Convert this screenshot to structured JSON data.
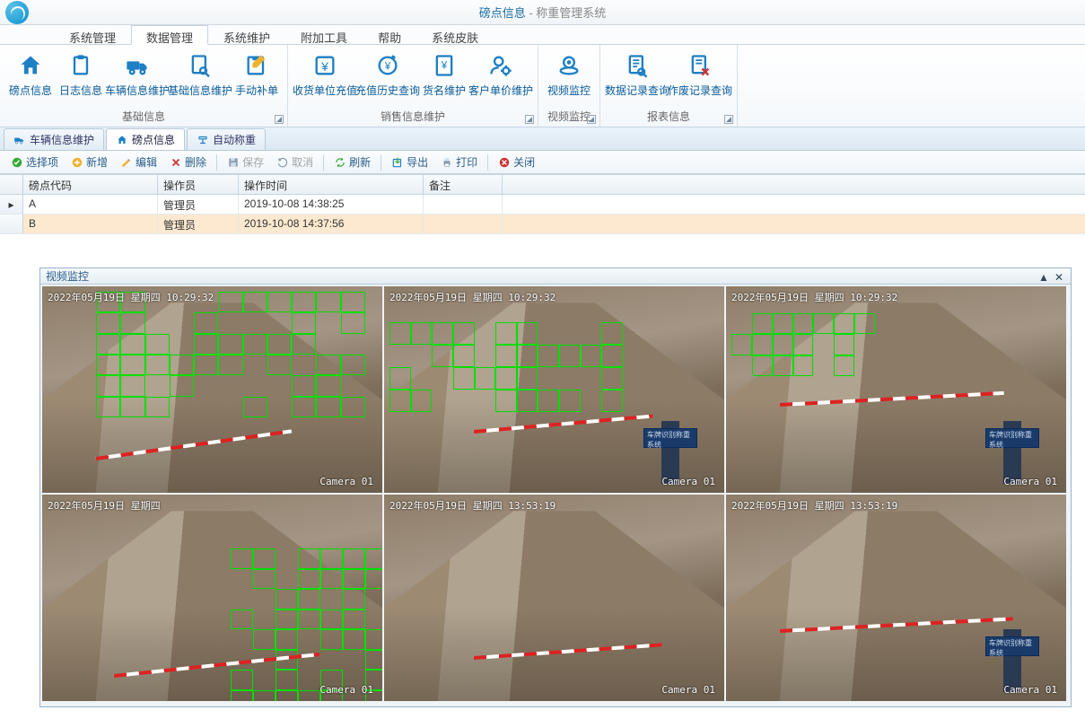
{
  "title": {
    "main": "磅点信息",
    "sub": " - 称重管理系统"
  },
  "mainmenu": [
    {
      "label": "系统管理"
    },
    {
      "label": "数据管理",
      "active": true
    },
    {
      "label": "系统维护"
    },
    {
      "label": "附加工具"
    },
    {
      "label": "帮助"
    },
    {
      "label": "系统皮肤"
    }
  ],
  "ribbon": {
    "groups": [
      {
        "title": "基础信息",
        "items": [
          {
            "label": "磅点信息",
            "icon": "home"
          },
          {
            "label": "日志信息",
            "icon": "clipboard"
          },
          {
            "label": "车辆信息维护",
            "icon": "truck"
          },
          {
            "label": "基础信息维护",
            "icon": "doc-search"
          },
          {
            "label": "手动补单",
            "icon": "edit"
          }
        ]
      },
      {
        "title": "销售信息维护",
        "items": [
          {
            "label": "收货单位充值",
            "icon": "yen"
          },
          {
            "label": "充值历史查询",
            "icon": "yen-refresh"
          },
          {
            "label": "货名维护",
            "icon": "doc-yen"
          },
          {
            "label": "客户单价维护",
            "icon": "user-gear"
          }
        ]
      },
      {
        "title": "视频监控",
        "items": [
          {
            "label": "视频监控",
            "icon": "camera"
          }
        ]
      },
      {
        "title": "报表信息",
        "items": [
          {
            "label": "数据记录查询",
            "icon": "report-search"
          },
          {
            "label": "作废记录查询",
            "icon": "report-x"
          }
        ]
      }
    ]
  },
  "doctabs": [
    {
      "label": "车辆信息维护",
      "icon": "truck",
      "active": false
    },
    {
      "label": "磅点信息",
      "icon": "home",
      "active": true
    },
    {
      "label": "自动称重",
      "icon": "scale",
      "active": false
    }
  ],
  "toolbar": [
    {
      "label": "选择项",
      "icon": "check",
      "disabled": false
    },
    {
      "label": "新增",
      "icon": "plus",
      "disabled": false
    },
    {
      "label": "编辑",
      "icon": "pencil",
      "disabled": false
    },
    {
      "label": "删除",
      "icon": "x",
      "disabled": false
    },
    {
      "sep": true
    },
    {
      "label": "保存",
      "icon": "save",
      "disabled": true
    },
    {
      "label": "取消",
      "icon": "undo",
      "disabled": true
    },
    {
      "sep": true
    },
    {
      "label": "刷新",
      "icon": "refresh",
      "disabled": false
    },
    {
      "sep": true
    },
    {
      "label": "导出",
      "icon": "export",
      "disabled": false
    },
    {
      "label": "打印",
      "icon": "print",
      "disabled": false
    },
    {
      "sep": true
    },
    {
      "label": "关闭",
      "icon": "close",
      "disabled": false
    }
  ],
  "grid": {
    "columns": [
      "磅点代码",
      "操作员",
      "操作时间",
      "备注"
    ],
    "rows": [
      {
        "code": "A",
        "op": "管理员",
        "time": "2019-10-08 14:38:25",
        "note": ""
      },
      {
        "code": "B",
        "op": "管理员",
        "time": "2019-10-08 14:37:56",
        "note": ""
      }
    ]
  },
  "video": {
    "title": "视频监控",
    "cams": [
      {
        "ts": "2022年05月19日 星期四 10:29:32",
        "label": "Camera 01"
      },
      {
        "ts": "2022年05月19日 星期四 10:29:32",
        "label": "Camera 01"
      },
      {
        "ts": "2022年05月19日 星期四 10:29:32",
        "label": "Camera 01"
      },
      {
        "ts": "2022年05月19日 星期四",
        "label": "Camera 01"
      },
      {
        "ts": "2022年05月19日 星期四 13:53:19",
        "label": "Camera 01"
      },
      {
        "ts": "2022年05月19日 星期四 13:53:19",
        "label": "Camera 01"
      }
    ],
    "sign_text": "车牌识别称重系统"
  }
}
